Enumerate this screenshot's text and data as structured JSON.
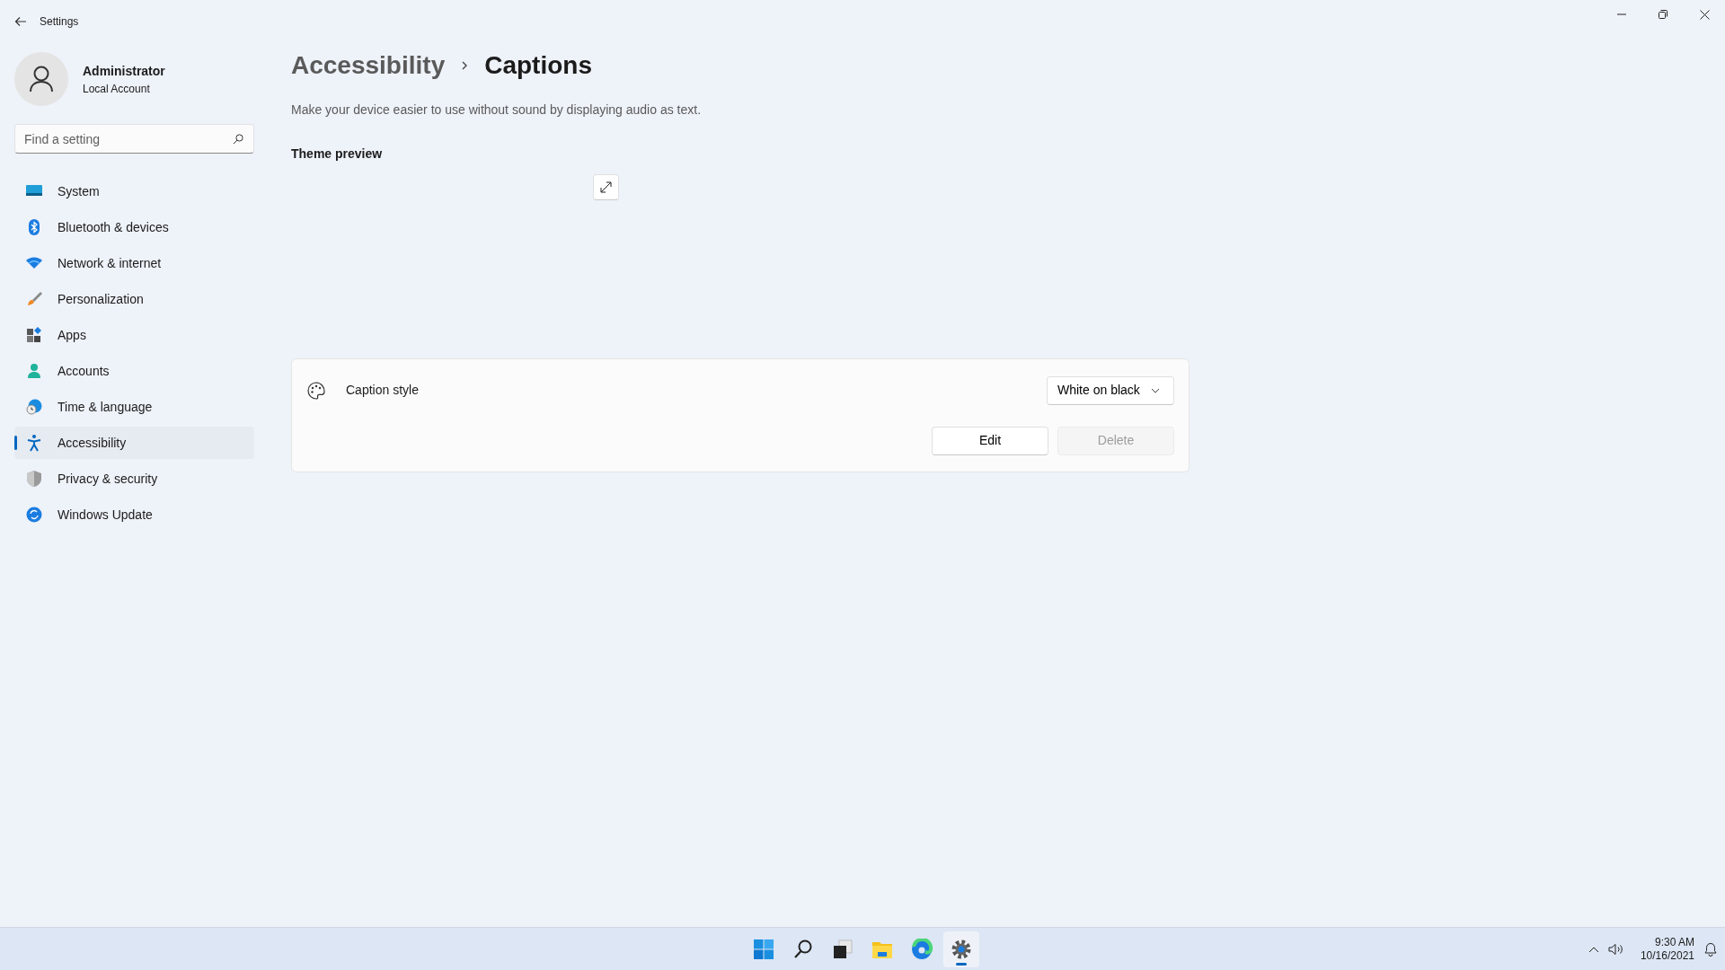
{
  "window": {
    "title": "Settings"
  },
  "account": {
    "name": "Administrator",
    "type": "Local Account"
  },
  "search": {
    "placeholder": "Find a setting"
  },
  "nav": [
    {
      "label": "System",
      "selected": false
    },
    {
      "label": "Bluetooth & devices",
      "selected": false
    },
    {
      "label": "Network & internet",
      "selected": false
    },
    {
      "label": "Personalization",
      "selected": false
    },
    {
      "label": "Apps",
      "selected": false
    },
    {
      "label": "Accounts",
      "selected": false
    },
    {
      "label": "Time & language",
      "selected": false
    },
    {
      "label": "Accessibility",
      "selected": true
    },
    {
      "label": "Privacy & security",
      "selected": false
    },
    {
      "label": "Windows Update",
      "selected": false
    }
  ],
  "breadcrumb": [
    "Accessibility",
    "Captions"
  ],
  "description": "Make your device easier to use without sound by displaying audio as text.",
  "theme_preview": {
    "label": "Theme preview"
  },
  "caption_style": {
    "label": "Caption style",
    "value": "White on black",
    "buttons": [
      {
        "label": "Edit",
        "disabled": false
      },
      {
        "label": "Delete",
        "disabled": true
      }
    ]
  },
  "taskbar": {
    "apps": [
      {
        "active": false
      },
      {
        "active": false
      },
      {
        "active": false
      },
      {
        "active": false
      },
      {
        "active": false
      },
      {
        "active": true
      }
    ],
    "time": "9:30 AM",
    "date": "10/16/2021"
  }
}
